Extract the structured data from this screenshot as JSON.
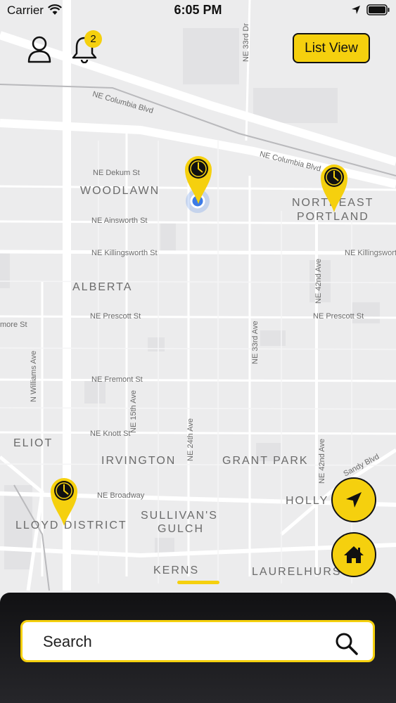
{
  "status_bar": {
    "carrier": "Carrier",
    "time": "6:05 PM"
  },
  "header": {
    "notification_count": "2",
    "list_view_label": "List View"
  },
  "map": {
    "areas": [
      "WOODLAWN",
      "NORTHEAST",
      "PORTLAND",
      "ALBERTA",
      "ELIOT",
      "IRVINGTON",
      "GRANT PARK",
      "HOLLY",
      "LLOYD DISTRICT",
      "SULLIVAN'S",
      "GULCH",
      "KERNS",
      "LAURELHURS"
    ],
    "streets": [
      "NE Columbia Blvd",
      "NE Columbia Blvd",
      "NE Dekum St",
      "NE Ainsworth St",
      "NE Killingsworth St",
      "NE Killingsworth",
      "NE Prescott St",
      "NE Prescott St",
      "more St",
      "NE Fremont St",
      "NE Knott St",
      "NE Broadway",
      "NE 33rd Dr",
      "NE 42nd Ave",
      "NE 33rd Ave",
      "N Williams Ave",
      "NE 15th Ave",
      "NE 24th Ave",
      "NE 42nd Ave",
      "Sandy Blvd"
    ]
  },
  "search": {
    "placeholder": "Search"
  },
  "colors": {
    "accent": "#f5d00e",
    "map_bg": "#ececed",
    "road": "#ffffff",
    "sheet": "#1a1a1c",
    "user_dot": "#3d7be6"
  },
  "icons": [
    "profile-icon",
    "bell-icon",
    "navigate-arrow-icon",
    "home-icon",
    "clock-pin-icon",
    "search-icon"
  ]
}
